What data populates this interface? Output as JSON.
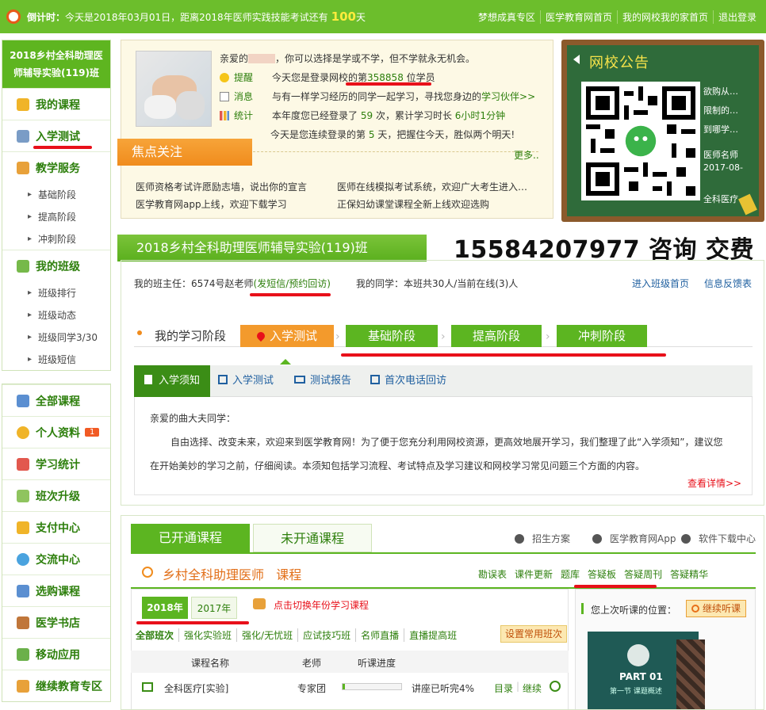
{
  "topbar": {
    "countdown_label": "倒计时：",
    "countdown_text": "今天是2018年03月01日，距离2018年医师实践技能考试还有",
    "countdown_days": "100",
    "countdown_unit": "天",
    "links": [
      "梦想成真专区",
      "医学教育网首页",
      "我的网校我的家首页",
      "退出登录"
    ]
  },
  "sidebar": {
    "title": "2018乡村全科助理医师辅导实验(119)班",
    "sections": [
      {
        "label": "我的课程",
        "icon": "book-icon"
      },
      {
        "label": "入学测试",
        "icon": "pencil-icon"
      },
      {
        "label": "教学服务",
        "icon": "service-icon",
        "items": [
          "基础阶段",
          "提高阶段",
          "冲刺阶段"
        ]
      },
      {
        "label": "我的班级",
        "icon": "class-icon",
        "items": [
          "班级排行",
          "班级动态",
          "班级同学3/30",
          "班级短信"
        ]
      }
    ],
    "menu": [
      {
        "label": "全部课程",
        "icon": "monitor-icon"
      },
      {
        "label": "个人资料",
        "icon": "user-icon",
        "badge": "1"
      },
      {
        "label": "学习统计",
        "icon": "chart-icon"
      },
      {
        "label": "班次升级",
        "icon": "upgrade-icon"
      },
      {
        "label": "支付中心",
        "icon": "pay-icon"
      },
      {
        "label": "交流中心",
        "icon": "chat-icon"
      },
      {
        "label": "选购课程",
        "icon": "cart-icon"
      },
      {
        "label": "医学书店",
        "icon": "bookstore-icon"
      },
      {
        "label": "移动应用",
        "icon": "mobile-icon"
      },
      {
        "label": "继续教育专区",
        "icon": "edu-icon"
      }
    ]
  },
  "welcome": {
    "greet_pre": "亲爱的",
    "greet_post": "，你可以选择是学或不学，但不学就永无机会。",
    "remind_tag": "提醒",
    "remind_text": "今天您是登录网校的第",
    "remind_num": "358858",
    "remind_unit": "位学员",
    "msg_tag": "消息",
    "msg_text": "与有一样学习经历的同学一起学习，寻找您身边的",
    "msg_link": "学习伙伴>>",
    "stat_tag": "统计",
    "stat_pre": "本年度您已经登录了",
    "stat_days": "59",
    "stat_mid": "次，累计学习时长",
    "stat_time": "6小时1分钟",
    "streak_pre": "今天是您连续登录的第",
    "streak_days": "5",
    "streak_post": "天，把握住今天，胜似两个明天!",
    "focus_title": "焦点关注",
    "more": "更多..",
    "news": [
      "医师资格考试许愿励志墙，说出你的宣言",
      "医师在线模拟考试系统，欢迎广大考生进入…",
      "医学教育网app上线，欢迎下载学习",
      "正保妇幼课堂课程全新上线欢迎选购"
    ]
  },
  "notice": {
    "title": "网校公告",
    "lines": [
      "欲购从…",
      "限制的…",
      "到哪学…",
      "",
      "医师名师",
      "2017-08-",
      "全科医疗"
    ]
  },
  "class": {
    "title": "2018乡村全科助理医师辅导实验(119)班",
    "phone": "15584207977 咨询 交费",
    "teacher_label": "我的班主任：6574号赵老师",
    "teacher_link": "发短信/预约回访",
    "classmates": "我的同学：本班共30人/当前在线(3)人",
    "enter_link": "进入班级首页",
    "feedback_link": "信息反馈表",
    "stage_label": "我的学习阶段",
    "stages": [
      "入学测试",
      "基础阶段",
      "提高阶段",
      "冲刺阶段"
    ],
    "tabs": [
      "入学须知",
      "入学测试",
      "测试报告",
      "首次电话回访"
    ],
    "notice_greet": "亲爱的曲大夫同学：",
    "notice_p1": "自由选择、改变未来，欢迎来到医学教育网！为了便于您充分利用网校资源，更高效地展开学习，我们整理了此“入学须知”，建议您",
    "notice_p2": "在开始美妙的学习之前，仔细阅读。本须知包括学习流程、考试特点及学习建议和网校学习常见问题三个方面的内容。",
    "detail_link": "查看详情>>"
  },
  "courses": {
    "tab_open": "已开通课程",
    "tab_closed": "未开通课程",
    "tools": [
      "招生方案",
      "医学教育网App",
      "软件下载中心"
    ],
    "course_title": "乡村全科助理医师",
    "course_suffix": "课程",
    "quick": [
      "勘误表",
      "课件更新",
      "题库",
      "答疑板",
      "答疑周刊",
      "答疑精华"
    ],
    "years": [
      "2018年",
      "2017年"
    ],
    "switch_hint": "点击切换年份学习课程",
    "filters": [
      "全部班次",
      "强化实验班",
      "强化/无忧班",
      "应试技巧班",
      "名师直播",
      "直播提高班"
    ],
    "set_common": "设置常用班次",
    "headers": [
      "课程名称",
      "老师",
      "听课进度"
    ],
    "row": {
      "name": "全科医疗[实验]",
      "teacher": "专家团",
      "progress": 0.04,
      "progress_text": "讲座已听完4%",
      "links": [
        "目录",
        "继续"
      ]
    },
    "last_label": "您上次听课的位置：",
    "continue_btn": "继续听课",
    "video_part": "PART 01",
    "video_sub": "第一节  课题概述"
  }
}
